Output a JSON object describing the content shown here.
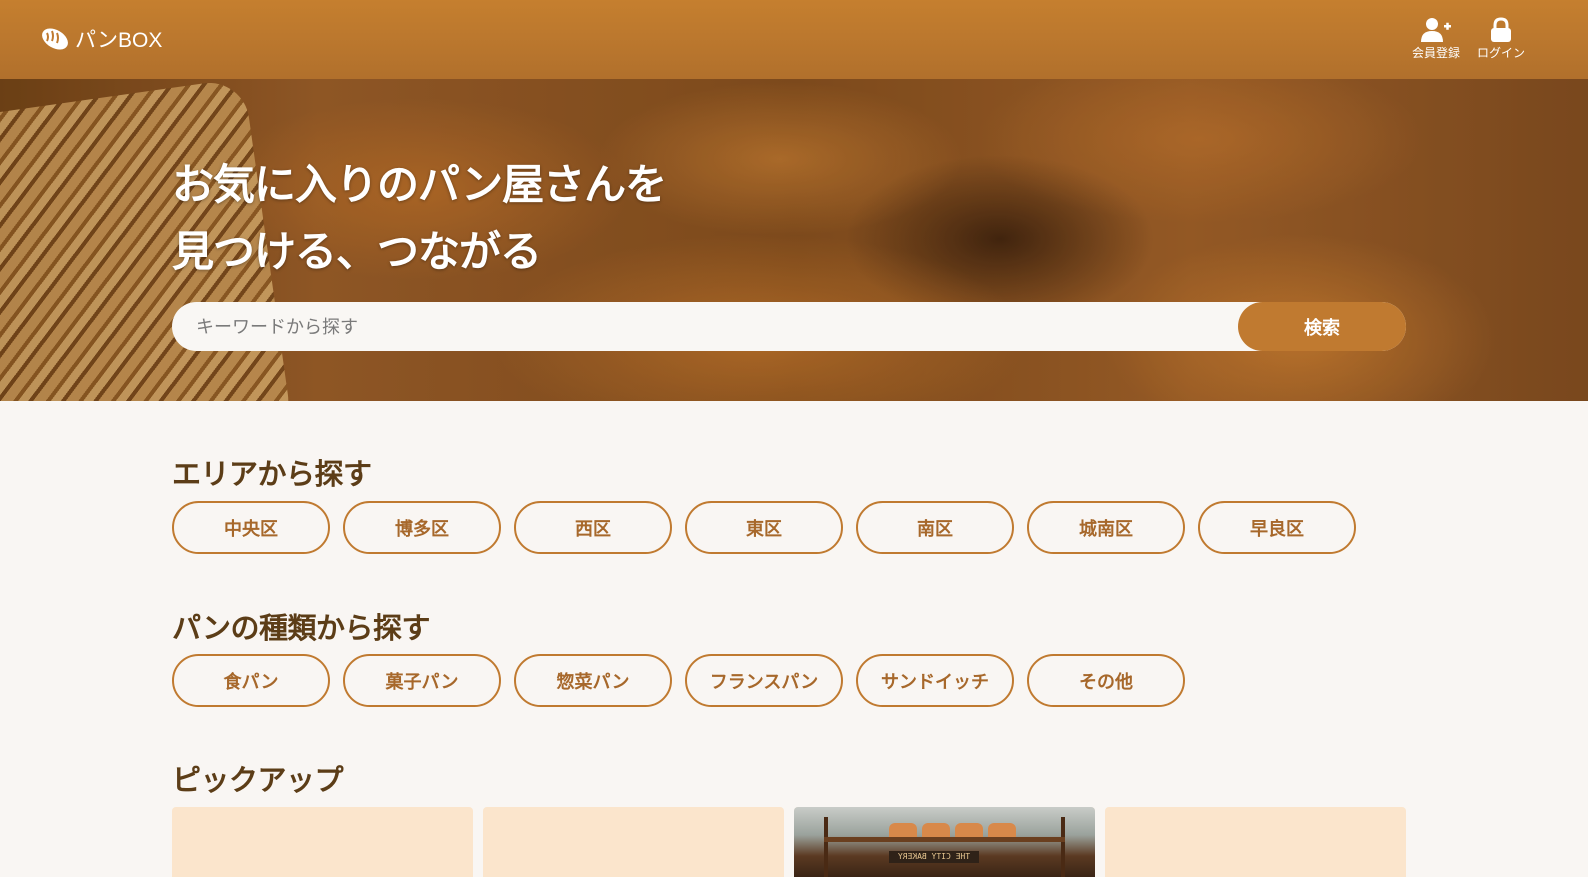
{
  "header": {
    "logo_text": "パンBOX",
    "logo_icon": "bread-icon",
    "register_label": "会員登録",
    "register_icon": "user-plus-icon",
    "login_label": "ログイン",
    "login_icon": "lock-icon"
  },
  "hero": {
    "title_line1": "お気に入りのパン屋さんを",
    "title_line2": "見つける、つながる",
    "search_placeholder": "キーワードから探す",
    "search_button": "検索"
  },
  "area_section": {
    "title": "エリアから探す",
    "items": [
      "中央区",
      "博多区",
      "西区",
      "東区",
      "南区",
      "城南区",
      "早良区"
    ]
  },
  "type_section": {
    "title": "パンの種類から探す",
    "items": [
      "食パン",
      "菓子パン",
      "惣菜パン",
      "フランスパン",
      "サンドイッチ",
      "その他"
    ]
  },
  "pickup_section": {
    "title": "ピックアップ",
    "card_count_visible": 4,
    "photo_card_sign_text": "THE CITY BAKERY"
  },
  "colors": {
    "header": "#b97630",
    "accent": "#c07a30",
    "heading_text": "#5c3d17",
    "pill_text": "#a7682b",
    "card_bg": "#fbe5cc",
    "page_bg": "#f9f6f3"
  }
}
